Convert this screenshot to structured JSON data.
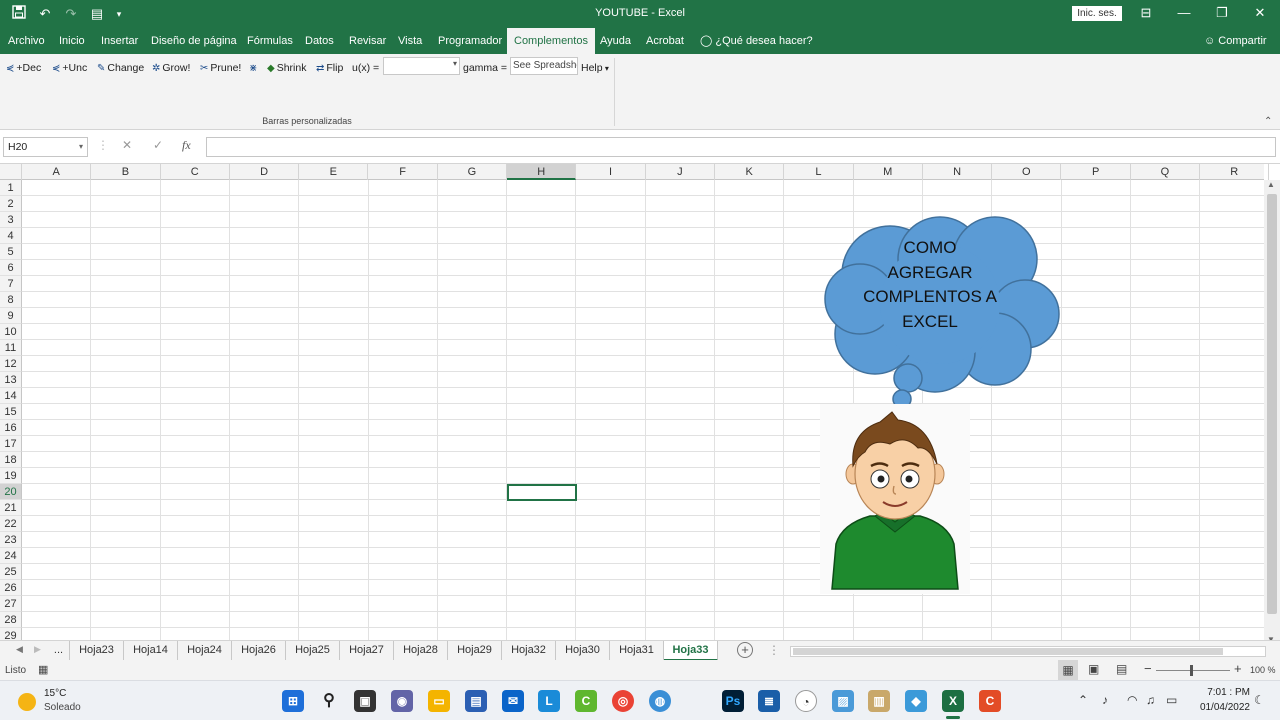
{
  "window": {
    "title": "YOUTUBE  -  Excel",
    "sign_in": "Inic. ses.",
    "minimize_glyph": "—",
    "maximize_glyph": "❐",
    "close_glyph": "✕",
    "ribbon_display_glyph": "⊟"
  },
  "quick_access": {
    "save_icon": "floppy-icon",
    "undo_icon": "undo-icon",
    "redo_icon": "redo-icon",
    "form_icon": "form-icon"
  },
  "ribbon_tabs": {
    "archivo": "Archivo",
    "inicio": "Inicio",
    "insertar": "Insertar",
    "diseno": "Diseño de página",
    "formulas": "Fórmulas",
    "datos": "Datos",
    "revisar": "Revisar",
    "vista": "Vista",
    "programador": "Programador",
    "complementos": "Complementos",
    "ayuda": "Ayuda",
    "acrobat": "Acrobat",
    "tell_me": "¿Qué desea hacer?",
    "share": "Compartir"
  },
  "ribbon": {
    "dec": "+Dec",
    "unc": "+Unc",
    "change": "Change",
    "grow": "Grow!",
    "prune": "Prune!",
    "shrink": "Shrink",
    "flip": "Flip",
    "ux_label": "u(x) =",
    "gamma_label": "gamma =",
    "spreadsheet_value": "See Spreadshe",
    "help": "Help",
    "group_label": "Barras personalizadas"
  },
  "formula_bar": {
    "name_box": "H20",
    "cancel_glyph": "✕",
    "enter_glyph": "✓",
    "fx_glyph": "fx",
    "formula": ""
  },
  "grid": {
    "columns": [
      "A",
      "B",
      "C",
      "D",
      "E",
      "F",
      "G",
      "H",
      "I",
      "J",
      "K",
      "L",
      "M",
      "N",
      "O",
      "P",
      "Q",
      "R"
    ],
    "rows": [
      "1",
      "2",
      "3",
      "4",
      "5",
      "6",
      "7",
      "8",
      "9",
      "10",
      "11",
      "12",
      "13",
      "14",
      "15",
      "16",
      "17",
      "18",
      "19",
      "20",
      "21",
      "22",
      "23",
      "24",
      "25",
      "26",
      "27",
      "28",
      "29"
    ],
    "selected_column": "H",
    "selected_row": "20"
  },
  "cloud_callout": {
    "line1": "COMO",
    "line2": "AGREGAR",
    "line3": "COMPLENTOS A",
    "line4": "EXCEL",
    "fill_color": "#5b9bd5"
  },
  "sheet_tabs": {
    "more": "...",
    "tabs": [
      "Hoja23",
      "Hoja14",
      "Hoja24",
      "Hoja26",
      "Hoja25",
      "Hoja27",
      "Hoja28",
      "Hoja29",
      "Hoja32",
      "Hoja30",
      "Hoja31",
      "Hoja33"
    ],
    "active": "Hoja33"
  },
  "status_bar": {
    "state": "Listo",
    "zoom": "100 %"
  },
  "taskbar": {
    "temperature": "15°C",
    "weather": "Soleado",
    "time": "7:01 : PM",
    "date": "01/04/2022"
  },
  "colors": {
    "excel_green": "#217346",
    "selection_green": "#217346"
  }
}
